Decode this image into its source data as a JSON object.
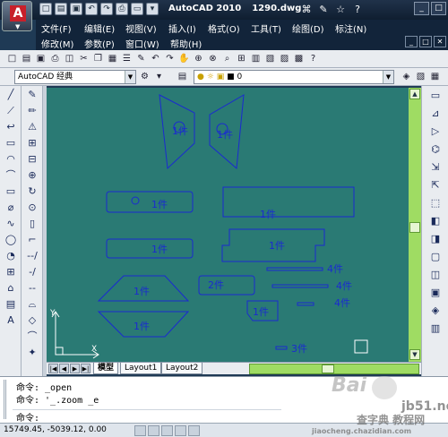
{
  "titlebar": {
    "app_letter": "A",
    "app_name": "AutoCAD 2010",
    "file_name": "1290.dwg",
    "quick_access": [
      "new-icon",
      "open-icon",
      "save-icon",
      "undo-icon",
      "redo-icon",
      "print-icon",
      "plot-icon",
      "dropdown-icon"
    ],
    "quick_access_glyphs": [
      "□",
      "▤",
      "▣",
      "↶",
      "↷",
      "⎙",
      "▭",
      "▾"
    ],
    "right_tools": [
      "binoculars-icon",
      "wrench-icon",
      "star-icon",
      "help-icon"
    ],
    "right_tool_glyphs": [
      "⌘",
      "✎",
      "☆",
      "?"
    ],
    "window_controls": [
      "_",
      "□",
      "✕"
    ]
  },
  "menu": {
    "row1": [
      "文件(F)",
      "编辑(E)",
      "视图(V)",
      "插入(I)",
      "格式(O)",
      "工具(T)",
      "绘图(D)",
      "标注(N)"
    ],
    "row2": [
      "修改(M)",
      "参数(P)",
      "窗口(W)",
      "帮助(H)"
    ],
    "mdi_controls": [
      "_",
      "□",
      "✕"
    ]
  },
  "toolbar1": {
    "icons": [
      "□",
      "▤",
      "▣",
      "⎙",
      "◫",
      "✂",
      "❐",
      "▦",
      "☰",
      "✎",
      "↶",
      "↷",
      "✋",
      "⊕",
      "⊗",
      "⌕",
      "⊞",
      "▥",
      "▧",
      "▨",
      "▩",
      "?"
    ]
  },
  "toolbar2": {
    "workspace": "AutoCAD 经典",
    "layer_value": "0",
    "layer_icons": [
      "💡",
      "☼",
      "🔓",
      "■"
    ]
  },
  "left_palette_1": [
    "╱",
    "⟋",
    "↩",
    "▭",
    "◠",
    "⌒",
    "▭",
    "⌀",
    "∿",
    "◯",
    "◔",
    "⊞",
    "⌂",
    "▤",
    "A",
    "",
    "",
    "",
    "",
    ""
  ],
  "left_palette_2": [
    "✎",
    "✏",
    "⚠",
    "⊞",
    "⊟",
    "⊕",
    "↻",
    "⊙",
    "▯",
    "⌐",
    "--/",
    "-/",
    "--",
    "⌓",
    "◇",
    "⌒",
    "✦",
    "",
    "",
    ""
  ],
  "right_palette": [
    "▭",
    "⊿",
    "▷",
    "⌬",
    "⇲",
    "⇱",
    "⬚",
    "◧",
    "◨",
    "▢",
    "◫",
    "▣",
    "◈",
    "▥"
  ],
  "drawing": {
    "labels": [
      "1件",
      "1件",
      "1件",
      "1件",
      "1件",
      "1件",
      "2件",
      "1件",
      "1件",
      "4件",
      "4件",
      "4件",
      "3件"
    ],
    "ucs_x": "X",
    "ucs_y": "Y"
  },
  "tabs": {
    "nav": [
      "|◀",
      "◀",
      "▶",
      "▶|"
    ],
    "items": [
      "模型",
      "Layout1",
      "Layout2"
    ]
  },
  "command": {
    "line1": "命令:  _open",
    "line2": "命令:  '_.zoom _e",
    "line3": "命令:"
  },
  "status": {
    "coords": "15749.45, -5039.12, 0.00"
  },
  "watermark": {
    "baidu": "Bai",
    "jb": "jb51.net",
    "cn": "查字典 教程网",
    "url": "jiaocheng.chazidian.com"
  },
  "colors": {
    "drawing_bg": "#2a7a74",
    "entity": "#1a2ad0",
    "scrollbar": "#9fdc63"
  }
}
